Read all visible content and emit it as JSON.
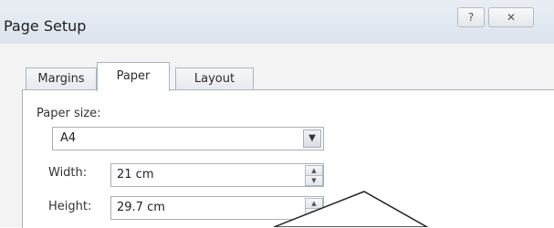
{
  "window": {
    "title": "Page Setup",
    "help_icon_label": "?",
    "close_icon_label": "✕"
  },
  "tabs": [
    {
      "label": "Margins",
      "active": false
    },
    {
      "label": "Paper",
      "active": true
    },
    {
      "label": "Layout",
      "active": false
    }
  ],
  "paper": {
    "size_label": "Paper size:",
    "size_value": "A4",
    "width_label": "Width:",
    "width_value": "21 cm",
    "height_label": "Height:",
    "height_value": "29.7 cm"
  },
  "icons": {
    "dropdown": "chevron-down-icon",
    "spin_up": "spin-up-icon",
    "spin_down": "spin-down-icon"
  }
}
